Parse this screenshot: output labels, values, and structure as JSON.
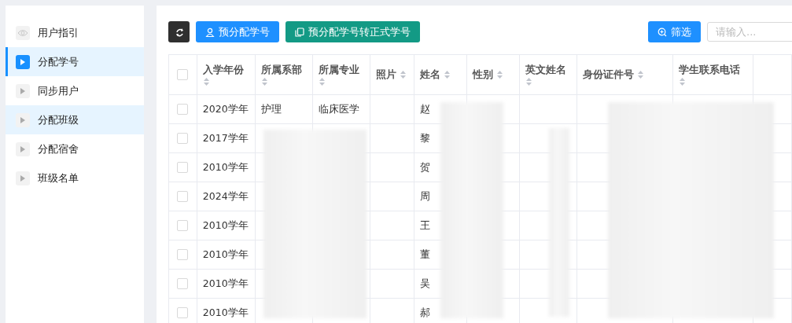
{
  "sidebar": {
    "items": [
      {
        "label": "用户指引",
        "kind": "eye",
        "selected": false,
        "hovered": false
      },
      {
        "label": "分配学号",
        "kind": "play",
        "selected": true,
        "hovered": false
      },
      {
        "label": "同步用户",
        "kind": "play",
        "selected": false,
        "hovered": false
      },
      {
        "label": "分配班级",
        "kind": "play",
        "selected": false,
        "hovered": true
      },
      {
        "label": "分配宿舍",
        "kind": "play",
        "selected": false,
        "hovered": false
      },
      {
        "label": "班级名单",
        "kind": "play",
        "selected": false,
        "hovered": false
      }
    ]
  },
  "toolbar": {
    "buttons": [
      {
        "kind": "refresh"
      },
      {
        "kind": "user",
        "label": "预分配学号"
      },
      {
        "kind": "copy",
        "label": "预分配学号转正式学号"
      }
    ],
    "filter_button": "筛选",
    "search": {
      "placeholder": "请输入..."
    }
  },
  "table": {
    "header_checked": false,
    "columns": [
      {
        "label": "入学年份",
        "sortable": true
      },
      {
        "label": "所属系部",
        "sortable": true
      },
      {
        "label": "所属专业",
        "sortable": true
      },
      {
        "label": "照片",
        "sortable": true
      },
      {
        "label": "姓名",
        "sortable": true
      },
      {
        "label": "性别",
        "sortable": true
      },
      {
        "label": "英文姓名",
        "sortable": true
      },
      {
        "label": "身份证件号",
        "sortable": true
      },
      {
        "label": "学生联系电话",
        "sortable": true
      }
    ],
    "rows": [
      {
        "checked": false,
        "cells": [
          "2020学年",
          "护理",
          "临床医学",
          "",
          "赵"
        ]
      },
      {
        "checked": false,
        "cells": [
          "2017学年",
          "",
          "",
          "",
          "黎"
        ]
      },
      {
        "checked": false,
        "cells": [
          "2010学年",
          "",
          "",
          "",
          "贺"
        ]
      },
      {
        "checked": false,
        "cells": [
          "2024学年",
          "",
          "",
          "",
          "周"
        ]
      },
      {
        "checked": false,
        "cells": [
          "2010学年",
          "",
          "",
          "",
          "王"
        ]
      },
      {
        "checked": false,
        "cells": [
          "2010学年",
          "",
          "",
          "",
          "董"
        ]
      },
      {
        "checked": false,
        "cells": [
          "2010学年",
          "",
          "",
          "",
          "吴"
        ]
      },
      {
        "checked": false,
        "cells": [
          "2010学年",
          "",
          "",
          "",
          "郝"
        ]
      }
    ]
  }
}
